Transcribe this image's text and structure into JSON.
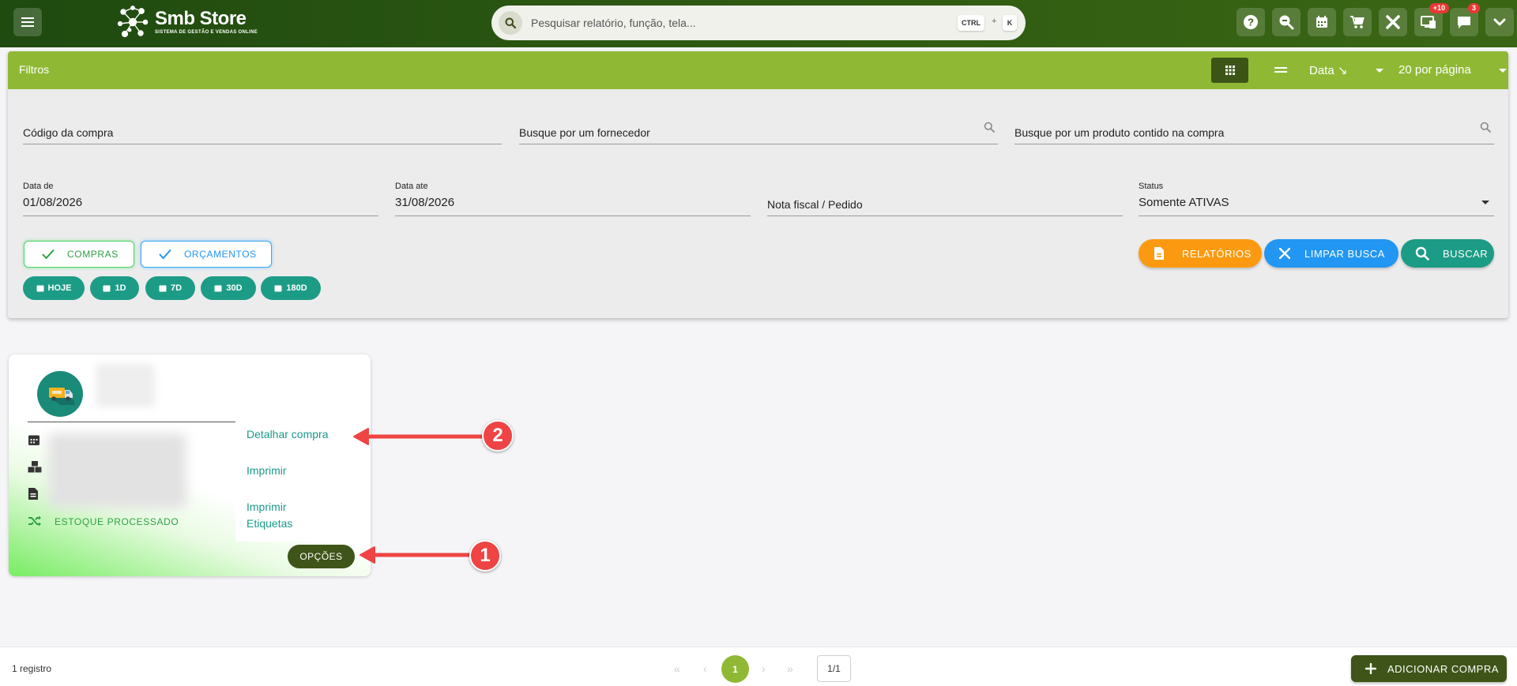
{
  "header": {
    "brand_title": "Smb Store",
    "brand_subtitle": "SISTEMA DE GESTÃO E VENDAS ONLINE",
    "search_placeholder": "Pesquisar relatório, função, tela...",
    "shortcut_key1": "CTRL",
    "shortcut_plus": "+",
    "shortcut_key2": "K",
    "notifications_badge": "+10",
    "messages_badge": "3",
    "icons": [
      "help-icon",
      "zoom-search-icon",
      "calendar-icon",
      "cart-icon",
      "tools-icon",
      "screen-icon",
      "chat-icon",
      "chevron-down-icon"
    ]
  },
  "filters": {
    "title": "Filtros",
    "sort_label": "Data ↘",
    "per_page_label": "20 por página",
    "purchase_code_placeholder": "Código da compra",
    "supplier_placeholder": "Busque por um fornecedor",
    "product_placeholder": "Busque por um produto contido na compra",
    "date_from_label": "Data de",
    "date_from_value": "01/08/2026",
    "date_to_label": "Data ate",
    "date_to_value": "31/08/2026",
    "invoice_placeholder": "Nota fiscal / Pedido",
    "status_label": "Status",
    "status_value": "Somente ATIVAS",
    "toggle_compras": "COMPRAS",
    "toggle_orcamentos": "ORÇAMENTOS",
    "quick_dates": [
      "HOJE",
      "1D",
      "7D",
      "30D",
      "180D"
    ],
    "reports_button": "RELATÓRIOS",
    "clear_button": "LIMPAR BUSCA",
    "search_button": "BUSCAR"
  },
  "card": {
    "stock_status": "ESTOQUE PROCESSADO",
    "menu_items": [
      "Detalhar compra",
      "Imprimir",
      "Imprimir Etiquetas"
    ],
    "options_button": "OPÇÕES"
  },
  "annotations": {
    "marker1": "1",
    "marker2": "2"
  },
  "footer": {
    "record_count": "1 registro",
    "current_page": "1",
    "page_of": "1/1",
    "add_button": "ADICIONAR COMPRA"
  },
  "colors": {
    "header_bg": "#2e5a12",
    "filter_bar": "#8fb935",
    "teal": "#1c9c86",
    "dark_olive": "#3e5418",
    "orange": "#fb9a10",
    "blue": "#2196f3",
    "annotation_red": "#ef4444"
  }
}
